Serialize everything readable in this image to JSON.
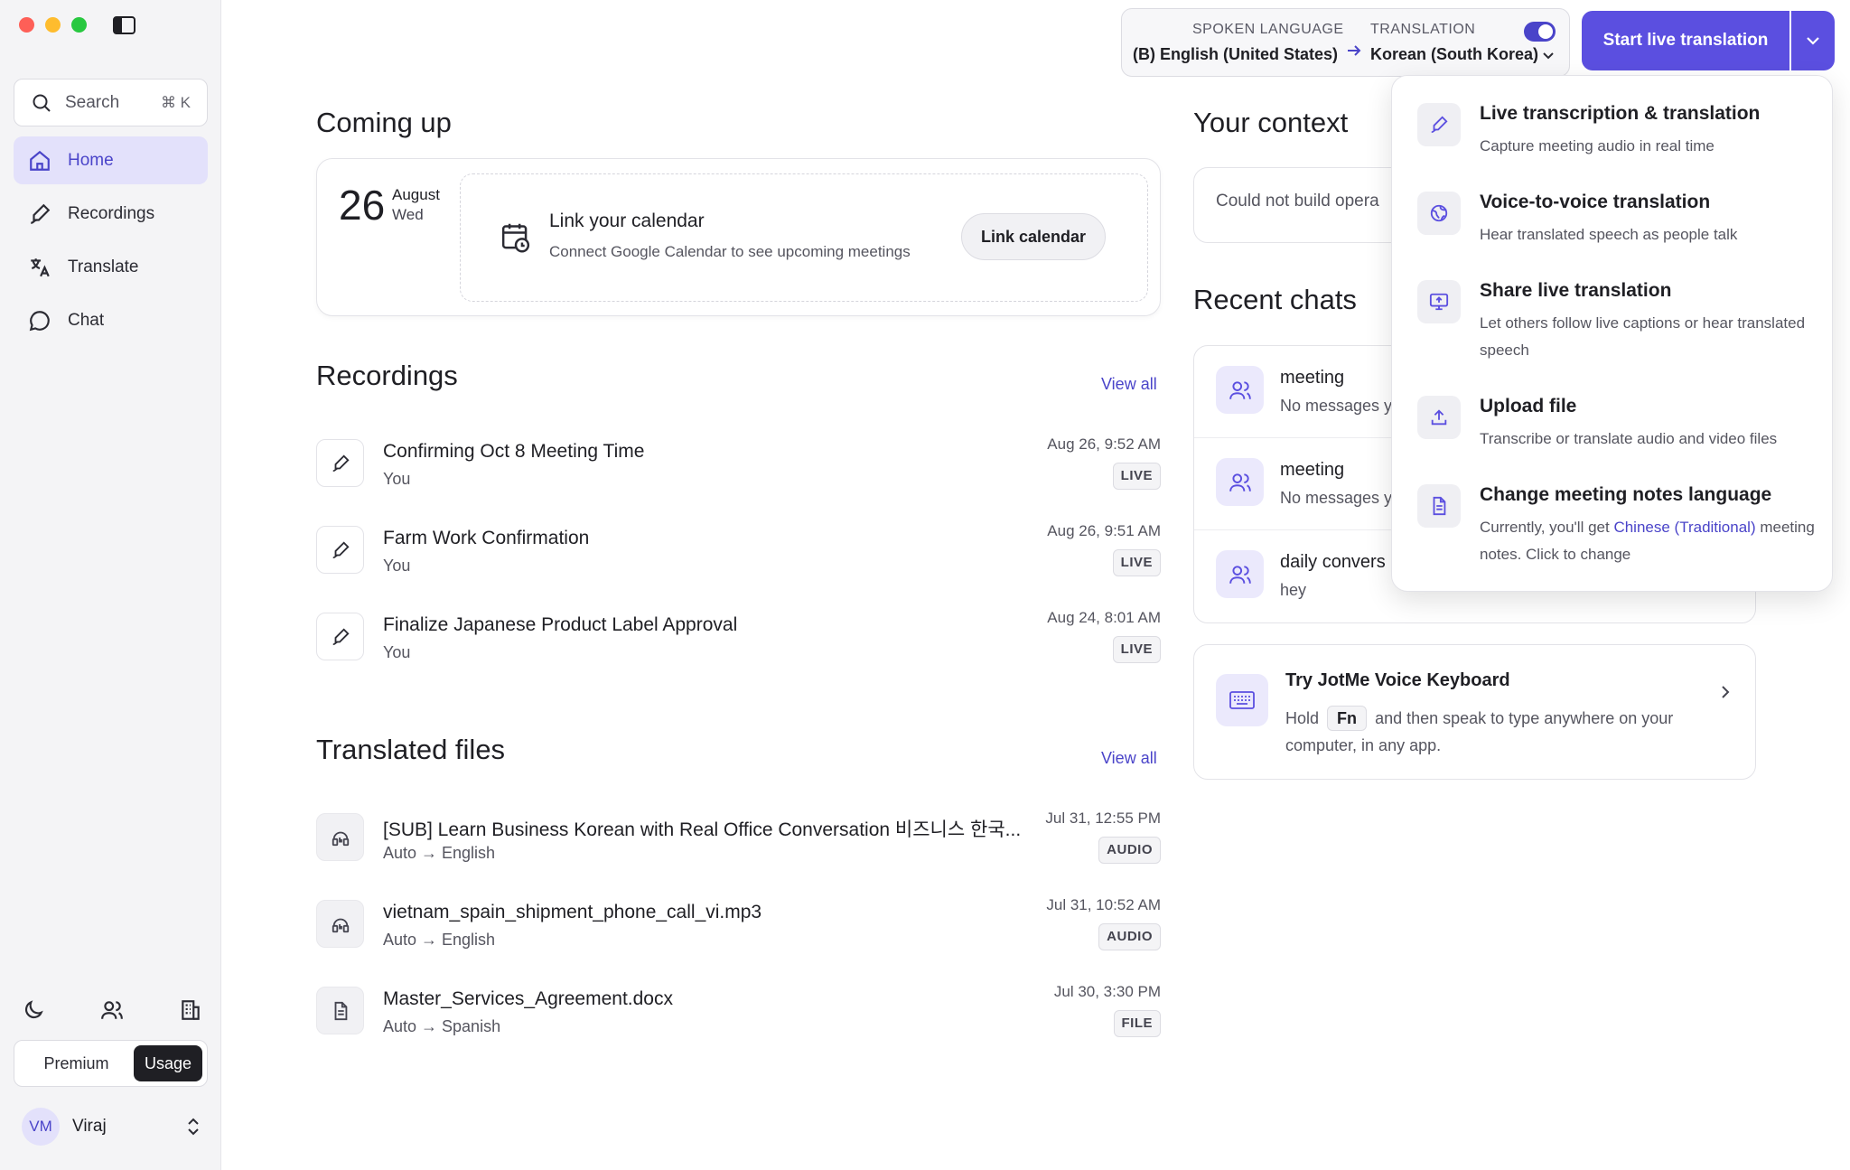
{
  "colors": {
    "accent": "#5b4fe0",
    "accent_text": "#4a44c9",
    "nav_active_bg": "#e3e1fb"
  },
  "sidebar": {
    "search": {
      "label": "Search",
      "shortcut": "⌘ K"
    },
    "items": [
      {
        "label": "Home",
        "icon": "home-icon",
        "active": true
      },
      {
        "label": "Recordings",
        "icon": "pen-icon"
      },
      {
        "label": "Translate",
        "icon": "translate-icon"
      },
      {
        "label": "Chat",
        "icon": "chat-bubble-icon"
      }
    ],
    "plan": {
      "premium": "Premium",
      "usage": "Usage"
    },
    "user": {
      "initials": "VM",
      "name": "Viraj"
    }
  },
  "header": {
    "spoken_label": "SPOKEN LANGUAGE",
    "spoken_value": "(B) English (United States)",
    "translation_label": "TRANSLATION",
    "translation_value": "Korean (South Korea)",
    "translation_enabled": true,
    "start_button": "Start live translation"
  },
  "coming_up": {
    "title": "Coming up",
    "day": "26",
    "month": "August",
    "weekday": "Wed",
    "link_title": "Link your calendar",
    "link_subtitle": "Connect Google Calendar to see upcoming meetings",
    "link_button": "Link calendar"
  },
  "recordings": {
    "title": "Recordings",
    "view_all": "View all",
    "items": [
      {
        "title": "Confirming Oct 8 Meeting Time",
        "sub": "You",
        "date": "Aug 26, 9:52 AM",
        "badge": "LIVE"
      },
      {
        "title": "Farm Work Confirmation",
        "sub": "You",
        "date": "Aug 26, 9:51 AM",
        "badge": "LIVE"
      },
      {
        "title": "Finalize Japanese Product Label Approval",
        "sub": "You",
        "date": "Aug 24, 8:01 AM",
        "badge": "LIVE"
      }
    ]
  },
  "translated_files": {
    "title": "Translated files",
    "view_all": "View all",
    "items": [
      {
        "title": "[SUB] Learn Business Korean with Real Office Conversation 비즈니스 한국...",
        "sub": "Auto → English",
        "date": "Jul 31, 12:55 PM",
        "badge": "AUDIO",
        "icon": "audio-file-icon"
      },
      {
        "title": "vietnam_spain_shipment_phone_call_vi.mp3",
        "sub": "Auto → English",
        "date": "Jul 31, 10:52 AM",
        "badge": "AUDIO",
        "icon": "audio-file-icon"
      },
      {
        "title": "Master_Services_Agreement.docx",
        "sub": "Auto → Spanish",
        "date": "Jul 30, 3:30 PM",
        "badge": "FILE",
        "icon": "document-icon"
      }
    ]
  },
  "context": {
    "title": "Your context",
    "text": "Could not build opera"
  },
  "recent_chats": {
    "title": "Recent chats",
    "items": [
      {
        "title": "meeting",
        "sub": "No messages y"
      },
      {
        "title": "meeting",
        "sub": "No messages y"
      },
      {
        "title": "daily convers",
        "sub": "hey"
      }
    ]
  },
  "keyboard_promo": {
    "title": "Try JotMe Voice Keyboard",
    "desc_before": "Hold",
    "key": "Fn",
    "desc_after": "and then speak to type anywhere on your computer, in any app."
  },
  "dropdown": {
    "items": [
      {
        "title": "Live transcription & translation",
        "desc": "Capture meeting audio in real time",
        "icon": "pen-icon"
      },
      {
        "title": "Voice-to-voice translation",
        "desc": "Hear translated speech as people talk",
        "icon": "globe-icon"
      },
      {
        "title": "Share live translation",
        "desc": "Let others follow live captions or hear translated speech",
        "icon": "screen-share-icon"
      },
      {
        "title": "Upload file",
        "desc": "Transcribe or translate audio and video files",
        "icon": "upload-icon"
      },
      {
        "title": "Change meeting notes language",
        "desc_before": "Currently, you'll get",
        "highlight": "Chinese (Traditional)",
        "desc_after": "meeting notes. Click to change",
        "icon": "document-icon"
      }
    ]
  }
}
